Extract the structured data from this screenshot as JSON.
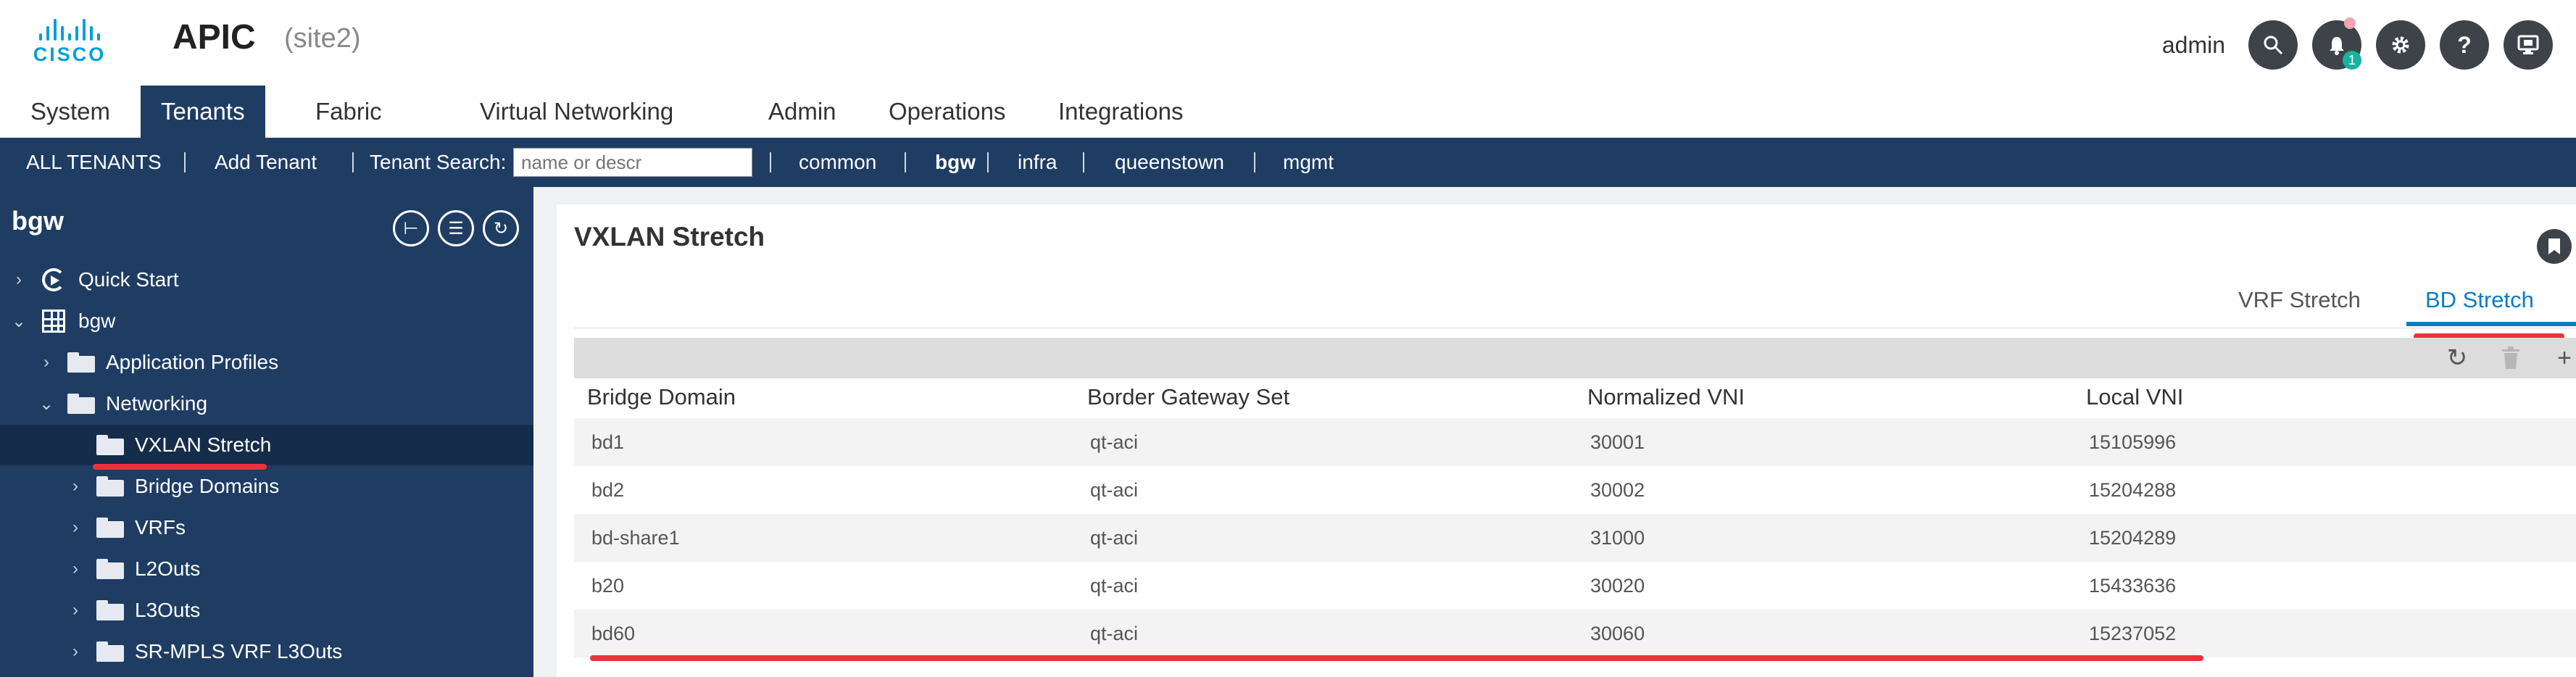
{
  "app": {
    "logo_text": "CISCO",
    "title": "APIC",
    "site": "(site2)"
  },
  "user": {
    "name": "admin",
    "notification_count": "1"
  },
  "main_tabs": [
    "System",
    "Tenants",
    "Fabric",
    "Virtual Networking",
    "Admin",
    "Operations",
    "Integrations"
  ],
  "tenant_bar": {
    "all_tenants": "ALL TENANTS",
    "add_tenant": "Add Tenant",
    "search_label": "Tenant Search:",
    "search_placeholder": "name or descr",
    "tenants": [
      "common",
      "bgw",
      "infra",
      "queenstown",
      "mgmt"
    ]
  },
  "sidebar": {
    "title": "bgw",
    "items": [
      {
        "label": "Quick Start",
        "icon": "quick-start-icon"
      },
      {
        "label": "bgw",
        "icon": "tenant-grid-icon"
      },
      {
        "label": "Application Profiles",
        "icon": "folder-icon"
      },
      {
        "label": "Networking",
        "icon": "folder-icon"
      },
      {
        "label": "VXLAN Stretch",
        "icon": "folder-icon"
      },
      {
        "label": "Bridge Domains",
        "icon": "folder-icon"
      },
      {
        "label": "VRFs",
        "icon": "folder-icon"
      },
      {
        "label": "L2Outs",
        "icon": "folder-icon"
      },
      {
        "label": "L3Outs",
        "icon": "folder-icon"
      },
      {
        "label": "SR-MPLS VRF L3Outs",
        "icon": "folder-icon"
      }
    ]
  },
  "main": {
    "title": "VXLAN Stretch",
    "subtabs": [
      "VRF Stretch",
      "BD Stretch"
    ],
    "active_subtab": "BD Stretch",
    "columns": [
      "Bridge Domain",
      "Border Gateway Set",
      "Normalized VNI",
      "Local VNI"
    ],
    "rows": [
      [
        "bd1",
        "qt-aci",
        "30001",
        "15105996"
      ],
      [
        "bd2",
        "qt-aci",
        "30002",
        "15204288"
      ],
      [
        "bd-share1",
        "qt-aci",
        "31000",
        "15204289"
      ],
      [
        "b20",
        "qt-aci",
        "30020",
        "15433636"
      ],
      [
        "bd60",
        "qt-aci",
        "30060",
        "15237052"
      ]
    ]
  },
  "colors": {
    "navy": "#1f3d63",
    "accent_blue": "#0a7cc2",
    "annotation_red": "#e8333c",
    "cisco_blue": "#049fd9"
  }
}
